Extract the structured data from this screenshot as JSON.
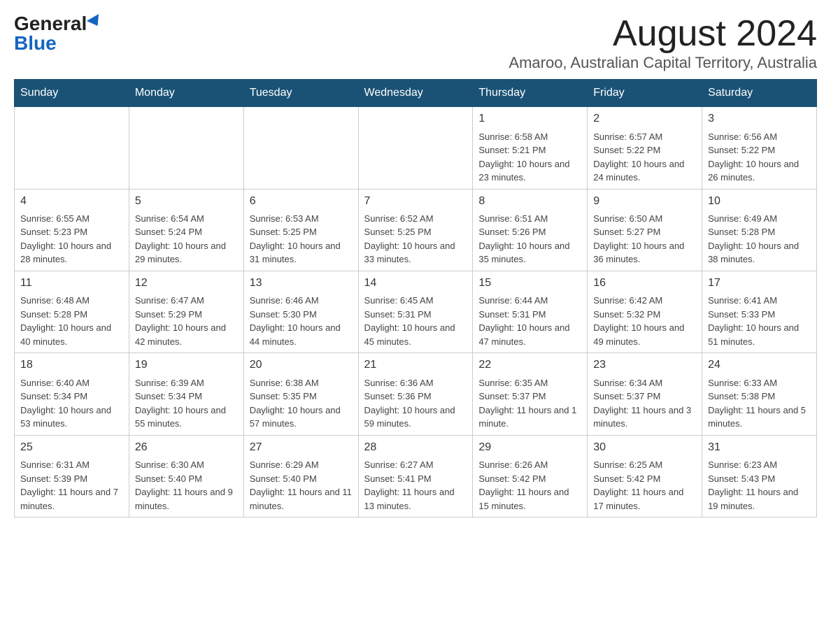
{
  "header": {
    "logo_general": "General",
    "logo_blue": "Blue",
    "month_title": "August 2024",
    "location": "Amaroo, Australian Capital Territory, Australia"
  },
  "days_of_week": [
    "Sunday",
    "Monday",
    "Tuesday",
    "Wednesday",
    "Thursday",
    "Friday",
    "Saturday"
  ],
  "weeks": [
    [
      {
        "day": "",
        "info": ""
      },
      {
        "day": "",
        "info": ""
      },
      {
        "day": "",
        "info": ""
      },
      {
        "day": "",
        "info": ""
      },
      {
        "day": "1",
        "info": "Sunrise: 6:58 AM\nSunset: 5:21 PM\nDaylight: 10 hours and 23 minutes."
      },
      {
        "day": "2",
        "info": "Sunrise: 6:57 AM\nSunset: 5:22 PM\nDaylight: 10 hours and 24 minutes."
      },
      {
        "day": "3",
        "info": "Sunrise: 6:56 AM\nSunset: 5:22 PM\nDaylight: 10 hours and 26 minutes."
      }
    ],
    [
      {
        "day": "4",
        "info": "Sunrise: 6:55 AM\nSunset: 5:23 PM\nDaylight: 10 hours and 28 minutes."
      },
      {
        "day": "5",
        "info": "Sunrise: 6:54 AM\nSunset: 5:24 PM\nDaylight: 10 hours and 29 minutes."
      },
      {
        "day": "6",
        "info": "Sunrise: 6:53 AM\nSunset: 5:25 PM\nDaylight: 10 hours and 31 minutes."
      },
      {
        "day": "7",
        "info": "Sunrise: 6:52 AM\nSunset: 5:25 PM\nDaylight: 10 hours and 33 minutes."
      },
      {
        "day": "8",
        "info": "Sunrise: 6:51 AM\nSunset: 5:26 PM\nDaylight: 10 hours and 35 minutes."
      },
      {
        "day": "9",
        "info": "Sunrise: 6:50 AM\nSunset: 5:27 PM\nDaylight: 10 hours and 36 minutes."
      },
      {
        "day": "10",
        "info": "Sunrise: 6:49 AM\nSunset: 5:28 PM\nDaylight: 10 hours and 38 minutes."
      }
    ],
    [
      {
        "day": "11",
        "info": "Sunrise: 6:48 AM\nSunset: 5:28 PM\nDaylight: 10 hours and 40 minutes."
      },
      {
        "day": "12",
        "info": "Sunrise: 6:47 AM\nSunset: 5:29 PM\nDaylight: 10 hours and 42 minutes."
      },
      {
        "day": "13",
        "info": "Sunrise: 6:46 AM\nSunset: 5:30 PM\nDaylight: 10 hours and 44 minutes."
      },
      {
        "day": "14",
        "info": "Sunrise: 6:45 AM\nSunset: 5:31 PM\nDaylight: 10 hours and 45 minutes."
      },
      {
        "day": "15",
        "info": "Sunrise: 6:44 AM\nSunset: 5:31 PM\nDaylight: 10 hours and 47 minutes."
      },
      {
        "day": "16",
        "info": "Sunrise: 6:42 AM\nSunset: 5:32 PM\nDaylight: 10 hours and 49 minutes."
      },
      {
        "day": "17",
        "info": "Sunrise: 6:41 AM\nSunset: 5:33 PM\nDaylight: 10 hours and 51 minutes."
      }
    ],
    [
      {
        "day": "18",
        "info": "Sunrise: 6:40 AM\nSunset: 5:34 PM\nDaylight: 10 hours and 53 minutes."
      },
      {
        "day": "19",
        "info": "Sunrise: 6:39 AM\nSunset: 5:34 PM\nDaylight: 10 hours and 55 minutes."
      },
      {
        "day": "20",
        "info": "Sunrise: 6:38 AM\nSunset: 5:35 PM\nDaylight: 10 hours and 57 minutes."
      },
      {
        "day": "21",
        "info": "Sunrise: 6:36 AM\nSunset: 5:36 PM\nDaylight: 10 hours and 59 minutes."
      },
      {
        "day": "22",
        "info": "Sunrise: 6:35 AM\nSunset: 5:37 PM\nDaylight: 11 hours and 1 minute."
      },
      {
        "day": "23",
        "info": "Sunrise: 6:34 AM\nSunset: 5:37 PM\nDaylight: 11 hours and 3 minutes."
      },
      {
        "day": "24",
        "info": "Sunrise: 6:33 AM\nSunset: 5:38 PM\nDaylight: 11 hours and 5 minutes."
      }
    ],
    [
      {
        "day": "25",
        "info": "Sunrise: 6:31 AM\nSunset: 5:39 PM\nDaylight: 11 hours and 7 minutes."
      },
      {
        "day": "26",
        "info": "Sunrise: 6:30 AM\nSunset: 5:40 PM\nDaylight: 11 hours and 9 minutes."
      },
      {
        "day": "27",
        "info": "Sunrise: 6:29 AM\nSunset: 5:40 PM\nDaylight: 11 hours and 11 minutes."
      },
      {
        "day": "28",
        "info": "Sunrise: 6:27 AM\nSunset: 5:41 PM\nDaylight: 11 hours and 13 minutes."
      },
      {
        "day": "29",
        "info": "Sunrise: 6:26 AM\nSunset: 5:42 PM\nDaylight: 11 hours and 15 minutes."
      },
      {
        "day": "30",
        "info": "Sunrise: 6:25 AM\nSunset: 5:42 PM\nDaylight: 11 hours and 17 minutes."
      },
      {
        "day": "31",
        "info": "Sunrise: 6:23 AM\nSunset: 5:43 PM\nDaylight: 11 hours and 19 minutes."
      }
    ]
  ]
}
